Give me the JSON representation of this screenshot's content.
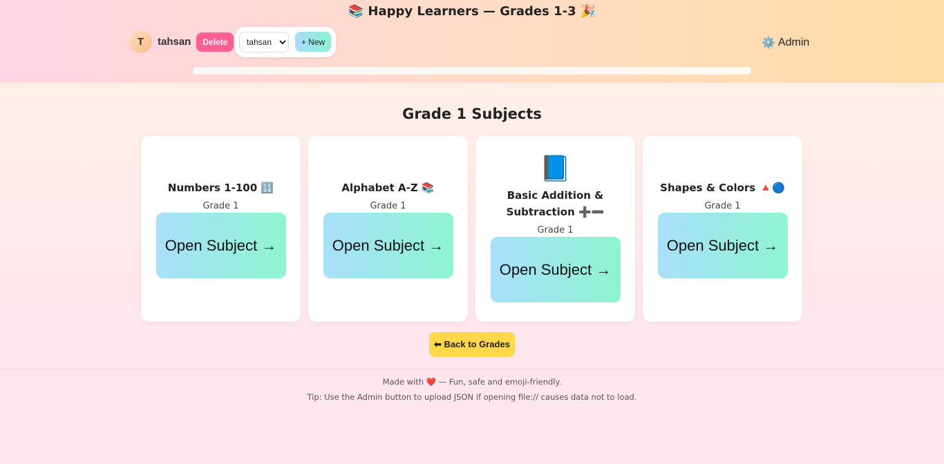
{
  "header": {
    "title": "📚 Happy Learners — Grades 1-3 🎉",
    "user": {
      "avatar_letter": "T",
      "name": "tahsan",
      "delete_label": "Delete",
      "selected_profile": "tahsan",
      "profile_options": [
        "tahsan"
      ],
      "new_label": "+ New"
    },
    "admin": {
      "icon": "⚙️",
      "label": "Admin"
    },
    "progress_fraction": 0
  },
  "main": {
    "section_title": "Grade 1 Subjects",
    "cards": [
      {
        "icon": "",
        "title": "Numbers 1-100 🔢",
        "grade": "Grade 1",
        "button_label": "Open Subject →"
      },
      {
        "icon": "",
        "title": "Alphabet A-Z 📚",
        "grade": "Grade 1",
        "button_label": "Open Subject →"
      },
      {
        "icon": "📘",
        "title": "Basic Addition & Subtraction ➕➖",
        "grade": "Grade 1",
        "button_label": "Open Subject →"
      },
      {
        "icon": "",
        "title": "Shapes & Colors 🔺🔵",
        "grade": "Grade 1",
        "button_label": "Open Subject →"
      }
    ],
    "back_label": "⬅ Back to Grades"
  },
  "footer": {
    "line1": "Made with ❤️ — Fun, safe and emoji-friendly.",
    "line2": "Tip: Use the Admin button to upload JSON if opening file:// causes data not to load."
  }
}
